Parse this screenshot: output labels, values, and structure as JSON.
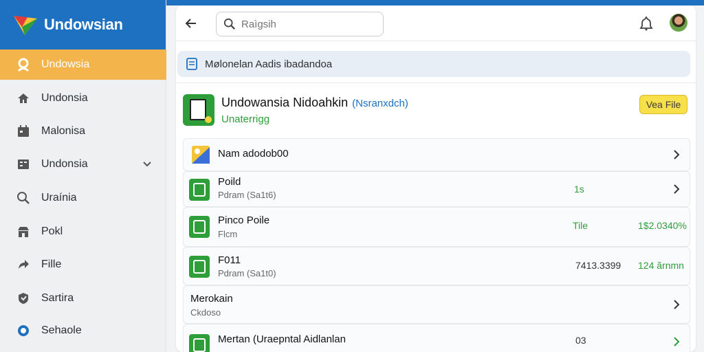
{
  "brand": {
    "name": "Undowsian",
    "logo_icon": "brand-logo-icon"
  },
  "sidebar": {
    "items": [
      {
        "label": "Undowsia",
        "icon": "user-icon",
        "active": true
      },
      {
        "label": "Undonsia",
        "icon": "home-icon",
        "active": false
      },
      {
        "label": "Malonisa",
        "icon": "calendar-icon",
        "active": false
      },
      {
        "label": "Undonsia",
        "icon": "grid-icon",
        "active": false,
        "expandable": true
      },
      {
        "label": "Uraínia",
        "icon": "search-icon",
        "active": false
      },
      {
        "label": "Pokl",
        "icon": "store-icon",
        "active": false
      },
      {
        "label": "Fille",
        "icon": "share-icon",
        "active": false
      },
      {
        "label": "Sartira",
        "icon": "shield-icon",
        "active": false
      },
      {
        "label": "Sehaole",
        "icon": "circle-icon",
        "active": false
      }
    ]
  },
  "header": {
    "search_placeholder": "Raìgsih"
  },
  "breadcrumb": {
    "text": "Mølonelan  Aadis ibadandoa"
  },
  "app_card": {
    "title": "Undowansia  Nidoahkin",
    "subtitle": "(Nsranxdch)",
    "status": "Unaterrigg",
    "button_label": "Vea File"
  },
  "rows": [
    {
      "name": "Nam adodob00",
      "sub": "",
      "mid": "",
      "right": "",
      "icon": "gallery-icon",
      "chevron": true
    },
    {
      "name": "Poild",
      "sub": "Pdram (Sa1t6)",
      "mid": "1s",
      "right": "",
      "icon": "file-icon",
      "chevron": true
    },
    {
      "name": "Pinco Poile",
      "sub": "Flcm",
      "mid": "Tile",
      "right": "1$2.0340%",
      "icon": "file-icon",
      "chevron": false
    },
    {
      "name": "F011",
      "sub": "Pdram (Sa1t0)",
      "mid": "7413.3399",
      "right": "124 ãrnmn",
      "icon": "file-icon",
      "chevron": false
    },
    {
      "name": "Merokain",
      "sub": "Ckdoso",
      "mid": "",
      "right": "",
      "icon": "",
      "chevron": true
    },
    {
      "name": "Mertan (Uraepntal Aidlanlan",
      "sub": "",
      "mid": "03",
      "right": "",
      "icon": "file-icon",
      "chevron": true
    }
  ],
  "colors": {
    "accent": "#1e70c1",
    "active": "#f3b54b",
    "green": "#2e9e3a",
    "button": "#f8e04a"
  }
}
